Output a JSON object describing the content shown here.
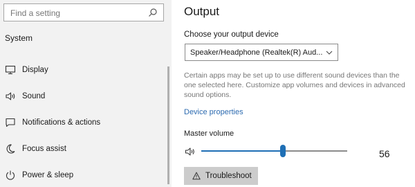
{
  "search": {
    "placeholder": "Find a setting",
    "icon": "search-icon"
  },
  "sidebar": {
    "section_label": "System",
    "items": [
      {
        "label": "Display",
        "icon": "monitor-icon"
      },
      {
        "label": "Sound",
        "icon": "speaker-icon"
      },
      {
        "label": "Notifications & actions",
        "icon": "notification-icon"
      },
      {
        "label": "Focus assist",
        "icon": "moon-icon"
      },
      {
        "label": "Power & sleep",
        "icon": "power-icon"
      }
    ]
  },
  "main": {
    "title": "Output",
    "choose_label": "Choose your output device",
    "device_selected": "Speaker/Headphone (Realtek(R) Aud...",
    "description": "Certain apps may be set up to use different sound devices than the one selected here. Customize app volumes and devices in advanced sound options.",
    "device_properties_link": "Device properties",
    "master_volume_label": "Master volume",
    "volume": 56,
    "troubleshoot_label": "Troubleshoot"
  },
  "colors": {
    "accent": "#1f6fb5",
    "link": "#2d6bb0",
    "sidebar_bg": "#f2f2f2"
  }
}
